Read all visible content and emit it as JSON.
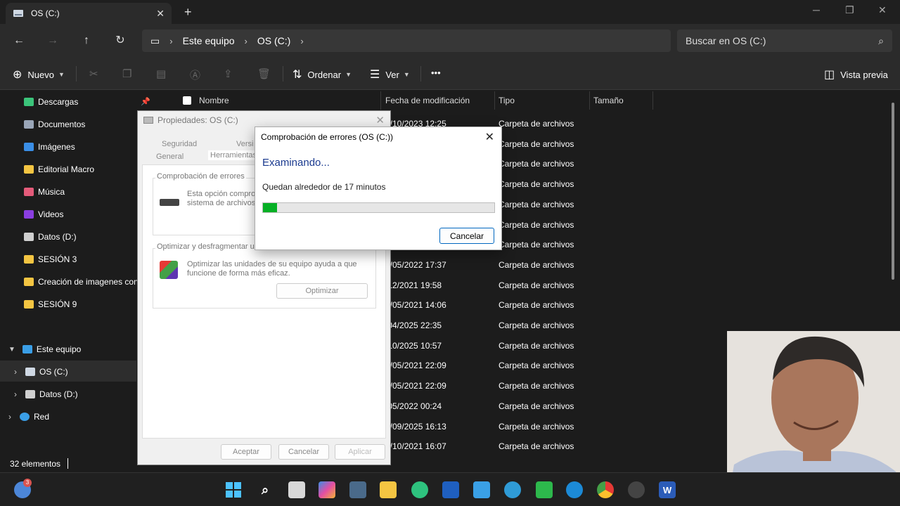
{
  "tab": {
    "title": "OS (C:)"
  },
  "address": {
    "segments": [
      "Este equipo",
      "OS (C:)"
    ]
  },
  "search": {
    "placeholder": "Buscar en OS (C:)"
  },
  "commands": {
    "new": "Nuevo",
    "sort": "Ordenar",
    "view": "Ver",
    "more": "•••",
    "preview": "Vista previa"
  },
  "sidebar": {
    "quick": [
      {
        "label": "Descargas",
        "icon": "download-icon",
        "color": "#3bc47a"
      },
      {
        "label": "Documentos",
        "icon": "document-icon",
        "color": "#9aa6b8"
      },
      {
        "label": "Imágenes",
        "icon": "pictures-icon",
        "color": "#3a8ee6"
      },
      {
        "label": "Editorial Macro",
        "icon": "folder-icon",
        "color": "#f4c542"
      },
      {
        "label": "Música",
        "icon": "music-icon",
        "color": "#e45b7a"
      },
      {
        "label": "Videos",
        "icon": "video-icon",
        "color": "#8a3ee0"
      },
      {
        "label": "Datos (D:)",
        "icon": "drive-icon",
        "color": "#cfcfcf"
      },
      {
        "label": "SESIÓN 3",
        "icon": "folder-icon",
        "color": "#f4c542"
      },
      {
        "label": "Creación de imagenes con",
        "icon": "folder-icon",
        "color": "#f4c542"
      },
      {
        "label": "SESIÓN 9",
        "icon": "folder-icon",
        "color": "#f4c542"
      }
    ],
    "thispc": "Este equipo",
    "drive_c": "OS (C:)",
    "drive_d": "Datos (D:)",
    "network": "Red"
  },
  "columns": {
    "name": "Nombre",
    "date": "Fecha de modificación",
    "type": "Tipo",
    "size": "Tamaño"
  },
  "rows": [
    {
      "date": "3/10/2023 12:25",
      "type": "Carpeta de archivos"
    },
    {
      "date": "",
      "type": "Carpeta de archivos"
    },
    {
      "date": "",
      "type": "Carpeta de archivos"
    },
    {
      "date": "",
      "type": "Carpeta de archivos"
    },
    {
      "date": "",
      "type": "Carpeta de archivos"
    },
    {
      "date": "",
      "type": "Carpeta de archivos"
    },
    {
      "date": "",
      "type": "Carpeta de archivos"
    },
    {
      "date": "0/05/2022 17:37",
      "type": "Carpeta de archivos"
    },
    {
      "date": "/12/2021 19:58",
      "type": "Carpeta de archivos"
    },
    {
      "date": "5/05/2021 14:06",
      "type": "Carpeta de archivos"
    },
    {
      "date": "/04/2025 22:35",
      "type": "Carpeta de archivos"
    },
    {
      "date": "/10/2025 10:57",
      "type": "Carpeta de archivos"
    },
    {
      "date": "7/05/2021 22:09",
      "type": "Carpeta de archivos"
    },
    {
      "date": "7/05/2021 22:09",
      "type": "Carpeta de archivos"
    },
    {
      "date": "/05/2022 00:24",
      "type": "Carpeta de archivos"
    },
    {
      "date": "4/09/2025 16:13",
      "type": "Carpeta de archivos"
    },
    {
      "date": "9/10/2021 16:07",
      "type": "Carpeta de archivos"
    }
  ],
  "status": {
    "count": "32 elementos"
  },
  "props": {
    "title": "Propiedades: OS (C:)",
    "tabs": {
      "security": "Seguridad",
      "versions": "Versi",
      "general": "General",
      "tools": "Herramientas"
    },
    "errcheck_group": "Comprobación de errores",
    "errcheck_text_1": "Esta opción comprob",
    "errcheck_text_2": "sistema de archivos",
    "optimize_group": "Optimizar y desfragmentar uni",
    "optimize_text_1": "Optimizar las unidades de su equipo ayuda a que",
    "optimize_text_2": "funcione de forma más eficaz.",
    "optimize_btn": "Optimizar",
    "ok": "Aceptar",
    "cancel": "Cancelar",
    "apply": "Aplicar"
  },
  "errdialog": {
    "title": "Comprobación de errores (OS (C:))",
    "heading": "Examinando...",
    "remaining": "Quedan alrededor de 17 minutos",
    "progress": 0.06,
    "cancel": "Cancelar"
  }
}
